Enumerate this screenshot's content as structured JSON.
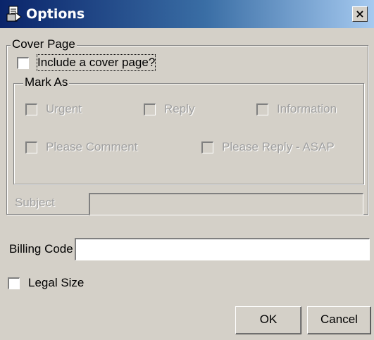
{
  "window": {
    "title": "Options",
    "close_label": "×"
  },
  "cover_page": {
    "legend": "Cover Page",
    "include_label": "Include a cover page?",
    "include_checked": false
  },
  "mark_as": {
    "legend": "Mark As",
    "options": [
      {
        "label": "Urgent",
        "checked": false
      },
      {
        "label": "Reply",
        "checked": false
      },
      {
        "label": "Information",
        "checked": false
      },
      {
        "label": "Please Comment",
        "checked": false
      },
      {
        "label": "Please Reply - ASAP",
        "checked": false
      }
    ]
  },
  "subject": {
    "label": "Subject",
    "value": ""
  },
  "billing": {
    "label": "Billing Code",
    "value": ""
  },
  "legal_size": {
    "label": "Legal Size",
    "checked": false
  },
  "buttons": {
    "ok": "OK",
    "cancel": "Cancel"
  }
}
